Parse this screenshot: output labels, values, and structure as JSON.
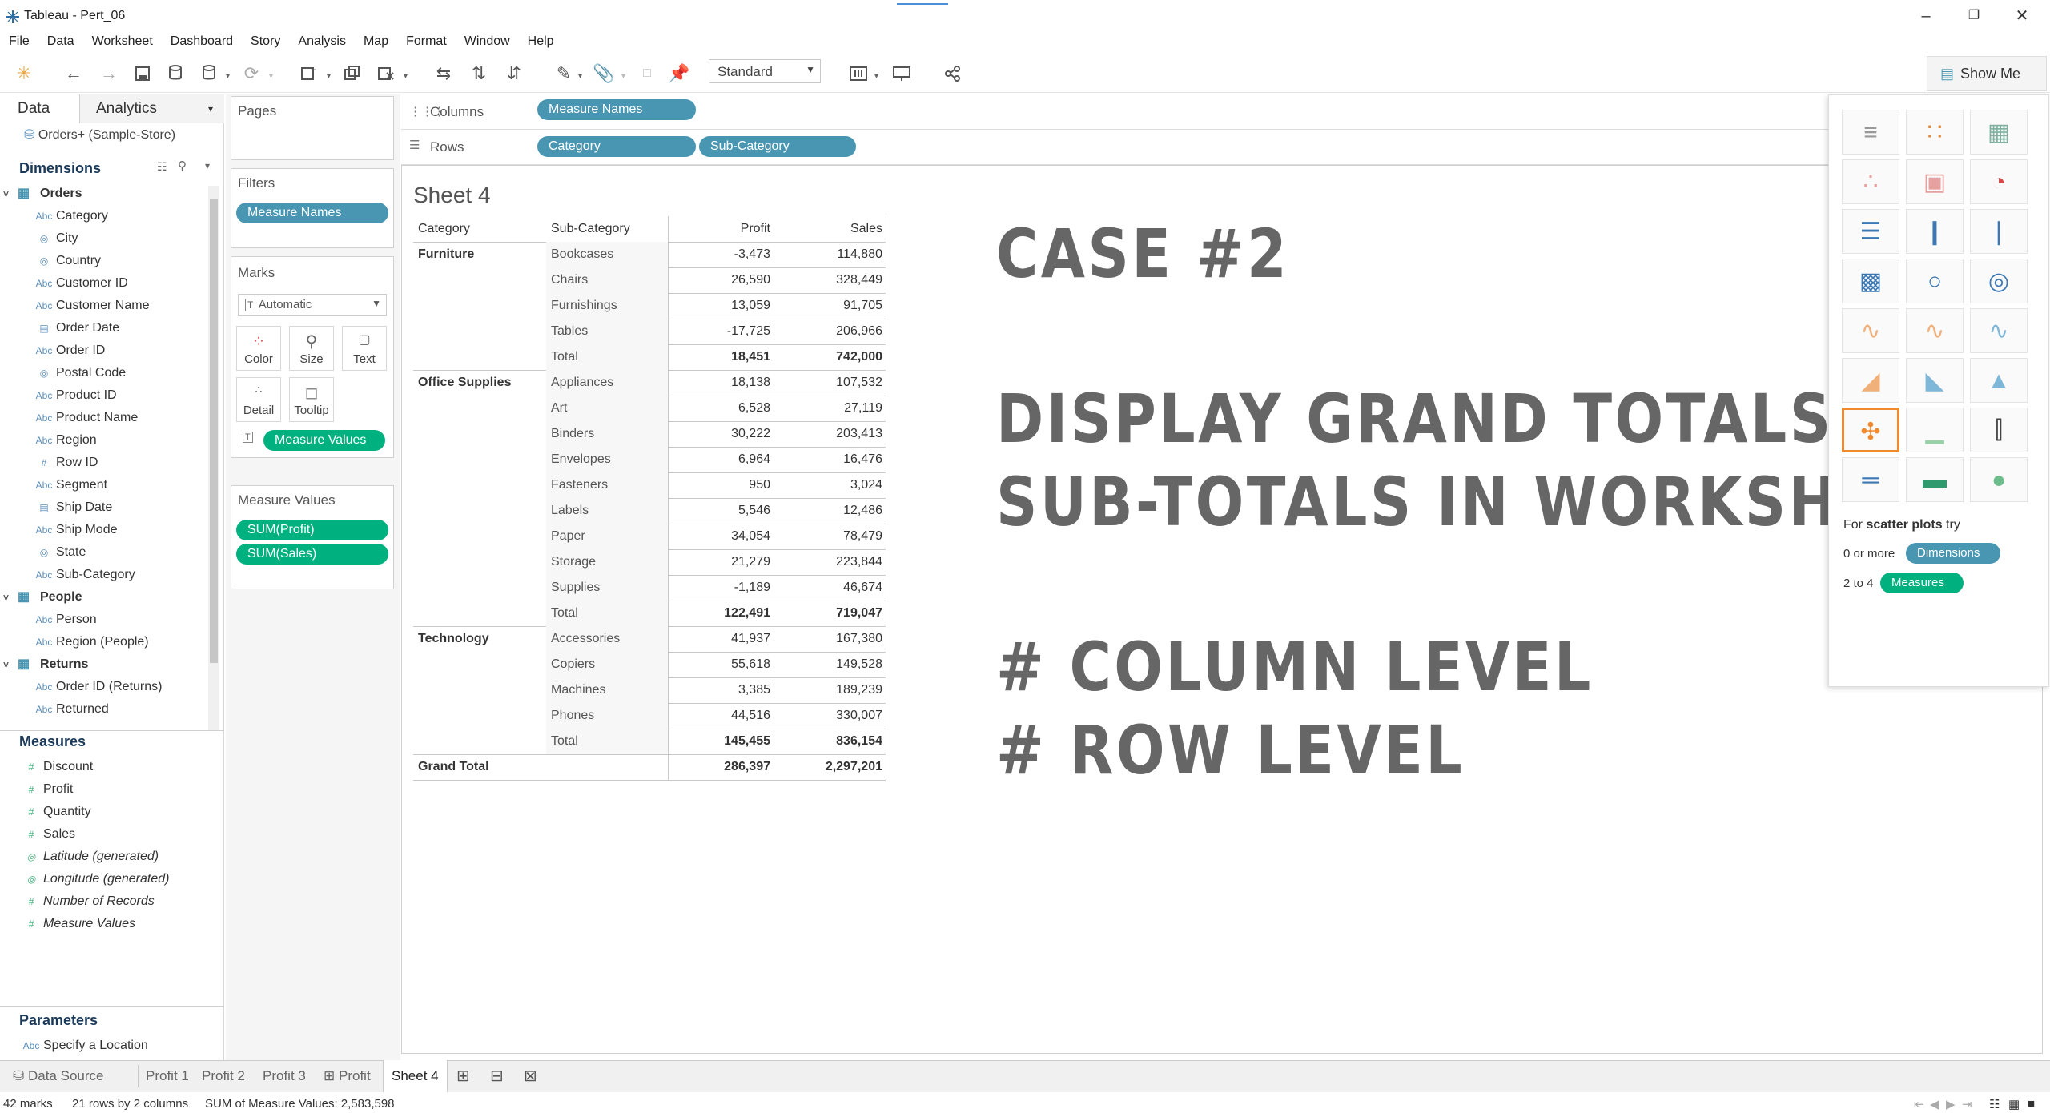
{
  "window": {
    "title": "Tableau - Pert_06"
  },
  "menu": [
    "File",
    "Data",
    "Worksheet",
    "Dashboard",
    "Story",
    "Analysis",
    "Map",
    "Format",
    "Window",
    "Help"
  ],
  "toolbar": {
    "mark_size_select": "Standard",
    "show_me_label": "Show Me"
  },
  "data_pane": {
    "tab_data": "Data",
    "tab_analytics": "Analytics",
    "datasource": "Orders+ (Sample-Store)",
    "dimensions_label": "Dimensions",
    "measures_label": "Measures",
    "parameters_label": "Parameters",
    "groups": [
      {
        "name": "Orders",
        "fields": [
          {
            "name": "Category",
            "icon": "Abc"
          },
          {
            "name": "City",
            "icon": "globe"
          },
          {
            "name": "Country",
            "icon": "globe"
          },
          {
            "name": "Customer ID",
            "icon": "Abc"
          },
          {
            "name": "Customer Name",
            "icon": "Abc"
          },
          {
            "name": "Order Date",
            "icon": "calendar"
          },
          {
            "name": "Order ID",
            "icon": "Abc"
          },
          {
            "name": "Postal Code",
            "icon": "globe"
          },
          {
            "name": "Product ID",
            "icon": "Abc"
          },
          {
            "name": "Product Name",
            "icon": "Abc"
          },
          {
            "name": "Region",
            "icon": "Abc"
          },
          {
            "name": "Row ID",
            "icon": "#"
          },
          {
            "name": "Segment",
            "icon": "Abc"
          },
          {
            "name": "Ship Date",
            "icon": "calendar"
          },
          {
            "name": "Ship Mode",
            "icon": "Abc"
          },
          {
            "name": "State",
            "icon": "globe"
          },
          {
            "name": "Sub-Category",
            "icon": "Abc"
          }
        ]
      },
      {
        "name": "People",
        "fields": [
          {
            "name": "Person",
            "icon": "Abc"
          },
          {
            "name": "Region (People)",
            "icon": "Abc"
          }
        ]
      },
      {
        "name": "Returns",
        "fields": [
          {
            "name": "Order ID (Returns)",
            "icon": "Abc"
          },
          {
            "name": "Returned",
            "icon": "Abc"
          }
        ]
      }
    ],
    "measures": [
      {
        "name": "Discount",
        "italic": false
      },
      {
        "name": "Profit",
        "italic": false
      },
      {
        "name": "Quantity",
        "italic": false
      },
      {
        "name": "Sales",
        "italic": false
      },
      {
        "name": "Latitude (generated)",
        "italic": true
      },
      {
        "name": "Longitude (generated)",
        "italic": true
      },
      {
        "name": "Number of Records",
        "italic": true
      },
      {
        "name": "Measure Values",
        "italic": true
      }
    ],
    "parameters": [
      {
        "name": "Specify a Location",
        "icon": "Abc"
      }
    ]
  },
  "shelves": {
    "pages_label": "Pages",
    "filters_label": "Filters",
    "filter_pill": "Measure Names",
    "marks_label": "Marks",
    "mark_type": "Automatic",
    "mark_buttons": [
      "Color",
      "Size",
      "Text",
      "Detail",
      "Tooltip"
    ],
    "text_pill": "Measure Values",
    "measure_values_label": "Measure Values",
    "measure_value_pills": [
      "SUM(Profit)",
      "SUM(Sales)"
    ],
    "columns_label": "Columns",
    "columns_pills": [
      "Measure Names"
    ],
    "rows_label": "Rows",
    "rows_pills": [
      "Category",
      "Sub-Category"
    ]
  },
  "sheet": {
    "title": "Sheet 4",
    "headers": [
      "Category",
      "Sub-Category",
      "Profit",
      "Sales"
    ],
    "groups": [
      {
        "category": "Furniture",
        "rows": [
          [
            "Bookcases",
            "-3,473",
            "114,880"
          ],
          [
            "Chairs",
            "26,590",
            "328,449"
          ],
          [
            "Furnishings",
            "13,059",
            "91,705"
          ],
          [
            "Tables",
            "-17,725",
            "206,966"
          ]
        ],
        "total": [
          "Total",
          "18,451",
          "742,000"
        ]
      },
      {
        "category": "Office Supplies",
        "rows": [
          [
            "Appliances",
            "18,138",
            "107,532"
          ],
          [
            "Art",
            "6,528",
            "27,119"
          ],
          [
            "Binders",
            "30,222",
            "203,413"
          ],
          [
            "Envelopes",
            "6,964",
            "16,476"
          ],
          [
            "Fasteners",
            "950",
            "3,024"
          ],
          [
            "Labels",
            "5,546",
            "12,486"
          ],
          [
            "Paper",
            "34,054",
            "78,479"
          ],
          [
            "Storage",
            "21,279",
            "223,844"
          ],
          [
            "Supplies",
            "-1,189",
            "46,674"
          ]
        ],
        "total": [
          "Total",
          "122,491",
          "719,047"
        ]
      },
      {
        "category": "Technology",
        "rows": [
          [
            "Accessories",
            "41,937",
            "167,380"
          ],
          [
            "Copiers",
            "55,618",
            "149,528"
          ],
          [
            "Machines",
            "3,385",
            "189,239"
          ],
          [
            "Phones",
            "44,516",
            "330,007"
          ]
        ],
        "total": [
          "Total",
          "145,455",
          "836,154"
        ]
      }
    ],
    "grand_total": [
      "Grand Total",
      "286,397",
      "2,297,201"
    ]
  },
  "overlay": {
    "line1": "CASE #2",
    "line2": "DISPLAY GRAND TOTALS &",
    "line3": "SUB-TOTALS IN WORKSHEET",
    "line4": "# COLUMN LEVEL",
    "line5": "# ROW LEVEL"
  },
  "showme": {
    "hint_prefix": "For",
    "hint_chart": "scatter plots",
    "hint_suffix": "try",
    "req1_text": "0 or more",
    "req1_pill": "Dimensions",
    "req2_text": "2 to 4",
    "req2_pill": "Measures"
  },
  "tabs": {
    "data_source": "Data Source",
    "sheets": [
      "Profit 1",
      "Profit 2",
      "Profit 3",
      "Profit",
      "Sheet 4"
    ],
    "active": "Sheet 4"
  },
  "status": {
    "marks": "42 marks",
    "dims": "21 rows by 2 columns",
    "sum": "SUM of Measure Values: 2,583,598"
  },
  "colors": {
    "pill_blue": "#4996b2",
    "pill_green": "#00b180",
    "overlay_text": "#666666",
    "selected_chart": "#f08a2c"
  }
}
